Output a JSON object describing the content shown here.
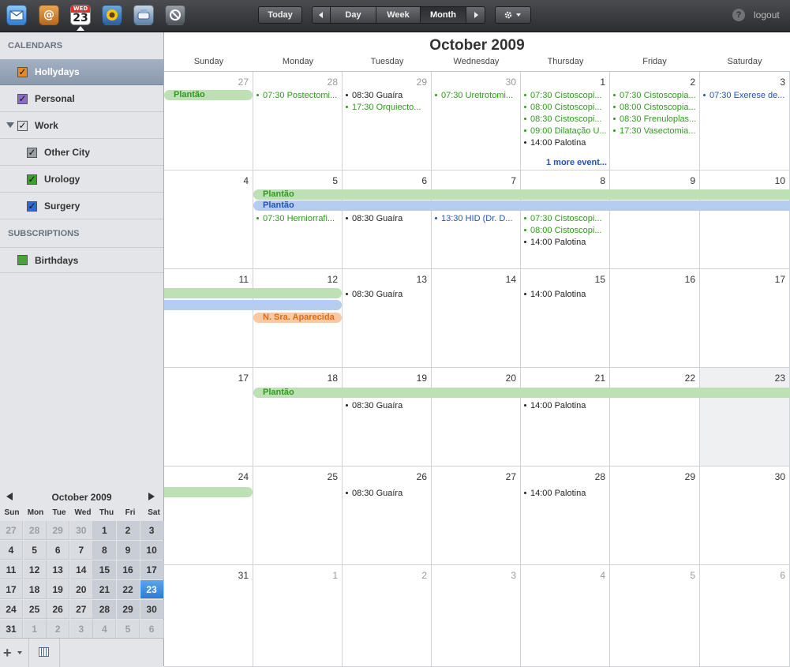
{
  "toolbar": {
    "calendar_icon_weekday": "WED",
    "calendar_icon_day": "23",
    "today_label": "Today",
    "day_label": "Day",
    "week_label": "Week",
    "month_label": "Month",
    "help_glyph": "?",
    "logout_label": "logout"
  },
  "sidebar": {
    "calendars_header": "CALENDARS",
    "subscriptions_header": "SUBSCRIPTIONS",
    "items": [
      {
        "label": "Hollydays",
        "color": "#e48a25"
      },
      {
        "label": "Personal",
        "color": "#8b6bc5"
      },
      {
        "label": "Work",
        "color": "#9aa0a8"
      },
      {
        "label": "Other City",
        "color": "#9aa0a8"
      },
      {
        "label": "Urology",
        "color": "#37a327"
      },
      {
        "label": "Surgery",
        "color": "#2c6bd6"
      }
    ],
    "subscriptions": [
      {
        "label": "Birthdays",
        "color": "#4aa33a"
      }
    ]
  },
  "minical": {
    "title": "October 2009",
    "dow": [
      "Sun",
      "Mon",
      "Tue",
      "Wed",
      "Thu",
      "Fri",
      "Sat"
    ],
    "weeks": [
      [
        "27",
        "28",
        "29",
        "30",
        "1",
        "2",
        "3"
      ],
      [
        "4",
        "5",
        "6",
        "7",
        "8",
        "9",
        "10"
      ],
      [
        "11",
        "12",
        "13",
        "14",
        "15",
        "16",
        "17"
      ],
      [
        "17",
        "18",
        "19",
        "20",
        "21",
        "22",
        "23"
      ],
      [
        "24",
        "25",
        "26",
        "27",
        "28",
        "29",
        "30"
      ],
      [
        "31",
        "1",
        "2",
        "3",
        "4",
        "5",
        "6"
      ]
    ]
  },
  "main": {
    "title": "October 2009",
    "dow": [
      "Sunday",
      "Monday",
      "Tuesday",
      "Wednesday",
      "Thursday",
      "Friday",
      "Saturday"
    ],
    "weeks": [
      [
        "27",
        "28",
        "29",
        "30",
        "1",
        "2",
        "3"
      ],
      [
        "4",
        "5",
        "6",
        "7",
        "8",
        "9",
        "10"
      ],
      [
        "11",
        "12",
        "13",
        "14",
        "15",
        "16",
        "17"
      ],
      [
        "17",
        "18",
        "19",
        "20",
        "21",
        "22",
        "23"
      ],
      [
        "24",
        "25",
        "26",
        "27",
        "28",
        "29",
        "30"
      ],
      [
        "31",
        "1",
        "2",
        "3",
        "4",
        "5",
        "6"
      ]
    ],
    "bars": [
      {
        "label": "Plantão",
        "color": "green"
      },
      {
        "label": "Plantão",
        "color": "green"
      },
      {
        "label": "Plantão",
        "color": "blue"
      },
      {
        "label": "",
        "color": "green"
      },
      {
        "label": "",
        "color": "blue"
      },
      {
        "label": "N. Sra. Aparecida",
        "color": "orange"
      },
      {
        "label": "Plantão",
        "color": "green"
      },
      {
        "label": "",
        "color": "green"
      }
    ],
    "events": [
      {
        "text": "07:30 Postectomi...",
        "color": "green"
      },
      {
        "text": "08:30 Guaíra",
        "color": "black"
      },
      {
        "text": "17:30 Orquiecto...",
        "color": "green"
      },
      {
        "text": "07:30 Uretrotomi...",
        "color": "green"
      },
      {
        "text": "07:30 Cistoscopi...",
        "color": "green"
      },
      {
        "text": "08:00 Cistoscopi...",
        "color": "green"
      },
      {
        "text": "08:30 Cistoscopi...",
        "color": "green"
      },
      {
        "text": "09:00 Dilatação U...",
        "color": "green"
      },
      {
        "text": "14:00 Palotina",
        "color": "black"
      },
      {
        "text": "07:30 Cistoscopia...",
        "color": "green"
      },
      {
        "text": "08:00 Cistoscopia...",
        "color": "green"
      },
      {
        "text": "08:30 Frenuloplas...",
        "color": "green"
      },
      {
        "text": "17:30 Vasectomia...",
        "color": "green"
      },
      {
        "text": "07:30 Exerese de...",
        "color": "blue"
      },
      {
        "text": "07:30 Herniorrafi...",
        "color": "green"
      },
      {
        "text": "08:30 Guaíra",
        "color": "black"
      },
      {
        "text": "13:30 HID (Dr. D...",
        "color": "blue"
      },
      {
        "text": "07:30 Cistoscopi...",
        "color": "green"
      },
      {
        "text": "08:00 Cistoscopi...",
        "color": "green"
      },
      {
        "text": "14:00 Palotina",
        "color": "black"
      },
      {
        "text": "08:30 Guaíra",
        "color": "black"
      },
      {
        "text": "14:00 Palotina",
        "color": "black"
      },
      {
        "text": "08:30 Guaíra",
        "color": "black"
      },
      {
        "text": "14:00 Palotina",
        "color": "black"
      },
      {
        "text": "08:30 Guaíra",
        "color": "black"
      },
      {
        "text": "14:00 Palotina",
        "color": "black"
      }
    ],
    "more_events": "1 more event..."
  }
}
